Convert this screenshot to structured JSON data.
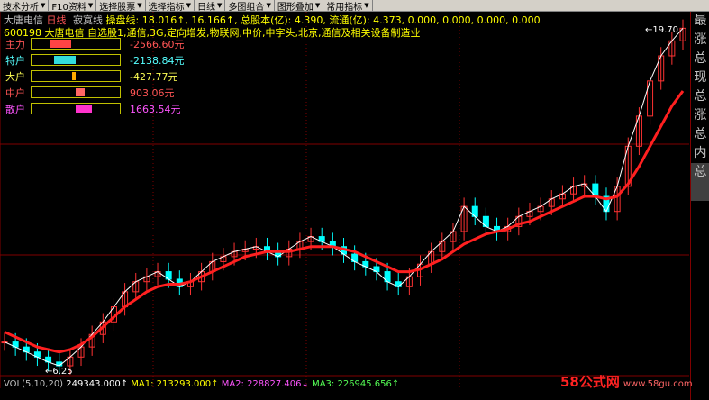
{
  "toolbar": {
    "items": [
      {
        "label": "技术分析"
      },
      {
        "label": "F10资料"
      },
      {
        "label": "选择股票"
      },
      {
        "label": "选择指标"
      },
      {
        "label": "日线"
      },
      {
        "label": "多图组合"
      },
      {
        "label": "图形叠加"
      },
      {
        "label": "常用指标"
      }
    ],
    "sep_glyph": "|"
  },
  "title": {
    "stock_name": "大唐电信",
    "period": "日线",
    "mode": "寂寞线",
    "text": "操盘线: 18.016↑, 16.166↑, 总股本(亿): 4.390, 流通(亿): 4.373, 0.000, 0.000, 0.000, 0.000"
  },
  "concept_line": "600198 大唐电信 自选股1,通信,3G,定向增发,物联网,中价,中字头,北京,通信及相关设备制造业",
  "funds": [
    {
      "label": "主力",
      "value": "-2566.60元",
      "color": "#ff5555",
      "fill": "#ff4444",
      "fill_from": 0.2,
      "fill_to": 0.45
    },
    {
      "label": "特户",
      "value": "-2138.84元",
      "color": "#55ffff",
      "fill": "#33dddd",
      "fill_from": 0.25,
      "fill_to": 0.5
    },
    {
      "label": "大户",
      "value": "-427.77元",
      "color": "#ffff55",
      "fill": "#ffaa00",
      "fill_from": 0.46,
      "fill_to": 0.5
    },
    {
      "label": "中户",
      "value": "903.06元",
      "color": "#ff5555",
      "fill": "#ff6666",
      "fill_from": 0.5,
      "fill_to": 0.6
    },
    {
      "label": "散户",
      "value": "1663.54元",
      "color": "#ff55ff",
      "fill": "#ff33cc",
      "fill_from": 0.5,
      "fill_to": 0.68
    }
  ],
  "price_labels": {
    "high": "19.70",
    "low": "6.25"
  },
  "right_panel": {
    "items": [
      "最",
      "涨",
      "总",
      "现",
      "总",
      "涨",
      "总",
      "内",
      "总",
      ""
    ]
  },
  "vol_line": {
    "prefix": "VOL(5,10,20)",
    "vol": "249343.000↑",
    "ma1": "MA1: 213293.000↑",
    "ma2": "MA2: 228827.406↓",
    "ma3": "MA3: 226945.656↑"
  },
  "watermark": {
    "main": "58公式网",
    "sub": "www.58gu.com"
  },
  "chart_data": {
    "type": "line",
    "title": "",
    "xlabel": "",
    "ylabel": "",
    "ylim": [
      6.0,
      20.0
    ],
    "high": 19.7,
    "low": 6.25,
    "series": [
      {
        "values": [
          7.2,
          7.0,
          6.8,
          6.6,
          6.4,
          6.25,
          6.6,
          7.0,
          7.5,
          8.0,
          8.6,
          9.2,
          9.6,
          9.8,
          10.0,
          9.7,
          9.4,
          9.6,
          10.0,
          10.4,
          10.6,
          10.8,
          10.9,
          11.0,
          10.8,
          10.6,
          10.9,
          11.2,
          11.4,
          11.2,
          11.0,
          10.7,
          10.4,
          10.2,
          10.0,
          9.6,
          9.4,
          9.8,
          10.3,
          10.8,
          11.2,
          11.6,
          12.6,
          12.2,
          11.8,
          11.6,
          11.8,
          12.2,
          12.4,
          12.6,
          12.9,
          13.1,
          13.4,
          13.5,
          13.0,
          12.4,
          13.4,
          15.0,
          16.2,
          17.6,
          18.6,
          19.2,
          19.7
        ]
      },
      {
        "values": [
          7.6,
          7.4,
          7.2,
          7.0,
          6.9,
          6.8,
          6.9,
          7.1,
          7.4,
          7.8,
          8.2,
          8.6,
          8.9,
          9.2,
          9.4,
          9.5,
          9.5,
          9.6,
          9.8,
          10.0,
          10.2,
          10.4,
          10.6,
          10.7,
          10.8,
          10.8,
          10.8,
          10.9,
          11.0,
          11.0,
          11.0,
          10.9,
          10.8,
          10.6,
          10.4,
          10.2,
          10.0,
          10.0,
          10.1,
          10.3,
          10.5,
          10.8,
          11.1,
          11.3,
          11.5,
          11.6,
          11.7,
          11.9,
          12.0,
          12.2,
          12.4,
          12.6,
          12.8,
          13.0,
          13.0,
          12.9,
          13.0,
          13.5,
          14.2,
          15.0,
          15.8,
          16.6,
          17.2
        ]
      }
    ]
  }
}
